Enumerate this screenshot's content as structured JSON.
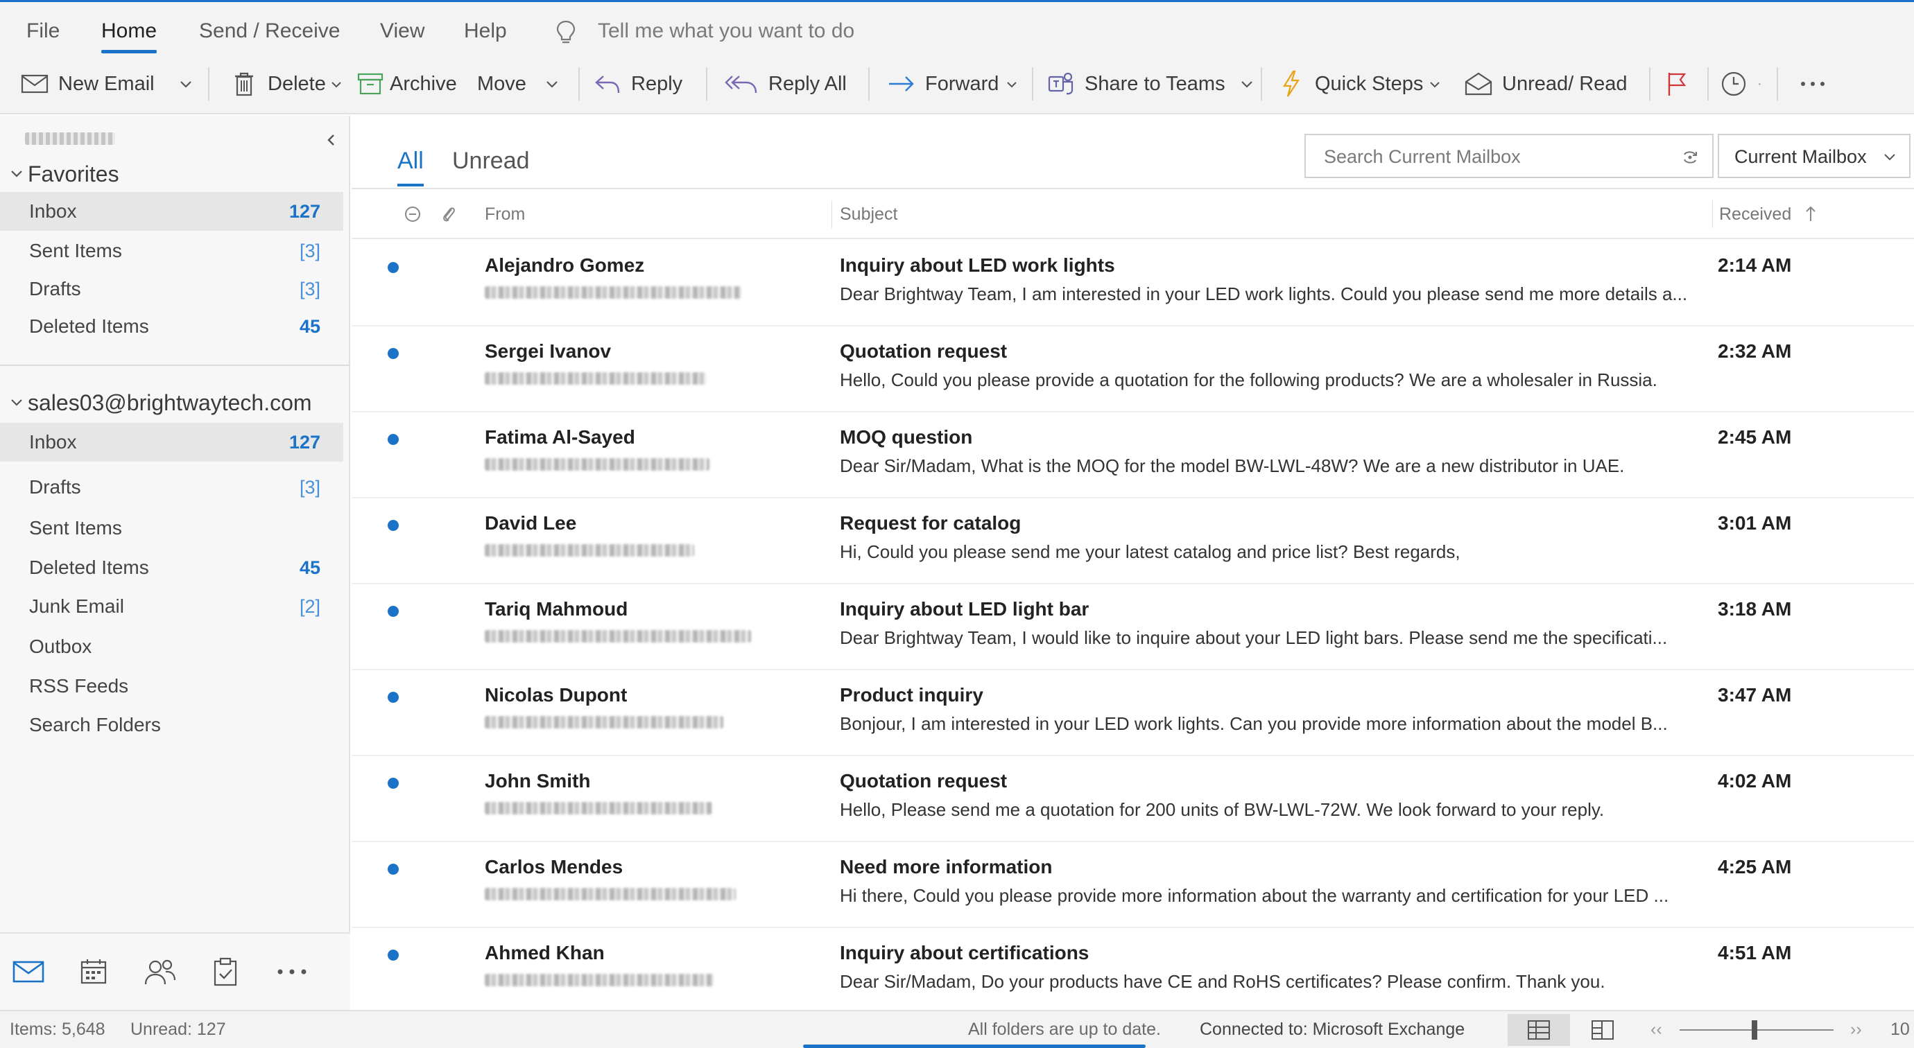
{
  "colors": {
    "accent": "#1a73c9",
    "unread_dot": "#1a73c9",
    "flag": "#d13438",
    "quick_steps": "#e8a317",
    "teams": "#6264a7"
  },
  "menu": {
    "file": "File",
    "home": "Home",
    "send_receive": "Send / Receive",
    "view": "View",
    "help": "Help",
    "tell_me": "Tell me what you want to do"
  },
  "toolbar": {
    "new_email": "New Email",
    "delete": "Delete",
    "archive": "Archive",
    "move": "Move",
    "reply": "Reply",
    "reply_all": "Reply All",
    "forward": "Forward",
    "share_teams": "Share to Teams",
    "quick_steps": "Quick Steps",
    "unread_read": "Unread/ Read"
  },
  "sidebar": {
    "favorites_label": "Favorites",
    "favorites": [
      {
        "label": "Inbox",
        "count": "127"
      },
      {
        "label": "Sent Items",
        "count": "[3]"
      },
      {
        "label": "Drafts",
        "count": "[3]"
      },
      {
        "label": "Deleted Items",
        "count": "45"
      }
    ],
    "account": "sales03@brightwaytech.com",
    "folders": [
      {
        "label": "Inbox",
        "count": "127"
      },
      {
        "label": "Drafts",
        "count": "[3]"
      },
      {
        "label": "Sent Items",
        "count": ""
      },
      {
        "label": "Deleted Items",
        "count": "45"
      },
      {
        "label": "Junk Email",
        "count": "[2]"
      },
      {
        "label": "Outbox",
        "count": ""
      },
      {
        "label": "RSS Feeds",
        "count": ""
      },
      {
        "label": "Search Folders",
        "count": ""
      }
    ]
  },
  "list": {
    "tab_all": "All",
    "tab_unread": "Unread",
    "search_placeholder": "Search Current Mailbox",
    "scope": "Current Mailbox",
    "col_from": "From",
    "col_subject": "Subject",
    "col_received": "Received",
    "messages": [
      {
        "sender": "Alejandro Gomez",
        "subject": "Inquiry about LED work lights",
        "preview": "Dear Brightway Team, I am interested in your LED work lights. Could you please send me more details a...",
        "received": "2:14 AM"
      },
      {
        "sender": "Sergei Ivanov",
        "subject": "Quotation request",
        "preview": "Hello, Could you please provide a quotation for the following products? We are a wholesaler in Russia.",
        "received": "2:32 AM"
      },
      {
        "sender": "Fatima Al-Sayed",
        "subject": "MOQ question",
        "preview": "Dear Sir/Madam, What is the MOQ for the model BW-LWL-48W? We are a new distributor in UAE.",
        "received": "2:45 AM"
      },
      {
        "sender": "David Lee",
        "subject": "Request for catalog",
        "preview": "Hi, Could you please send me your latest catalog and price list? Best regards,",
        "received": "3:01 AM"
      },
      {
        "sender": "Tariq Mahmoud",
        "subject": "Inquiry about LED light bar",
        "preview": "Dear Brightway Team, I would like to inquire about your LED light bars. Please send me the specificati...",
        "received": "3:18 AM"
      },
      {
        "sender": "Nicolas Dupont",
        "subject": "Product inquiry",
        "preview": "Bonjour, I am interested in your LED work lights. Can you provide more information about the model B...",
        "received": "3:47 AM"
      },
      {
        "sender": "John Smith",
        "subject": "Quotation request",
        "preview": "Hello, Please send me a quotation for 200 units of BW-LWL-72W. We look forward to your reply.",
        "received": "4:02 AM"
      },
      {
        "sender": "Carlos Mendes",
        "subject": "Need more information",
        "preview": "Hi there, Could you please provide more information about the warranty and certification for your LED ...",
        "received": "4:25 AM"
      },
      {
        "sender": "Ahmed Khan",
        "subject": "Inquiry about certifications",
        "preview": "Dear Sir/Madam, Do your products have CE and RoHS certificates? Please confirm. Thank you.",
        "received": "4:51 AM"
      }
    ]
  },
  "status": {
    "items": "Items: 5,648",
    "unread": "Unread: 127",
    "sync": "All folders are up to date.",
    "connection": "Connected to: Microsoft Exchange",
    "zoom": "10"
  }
}
